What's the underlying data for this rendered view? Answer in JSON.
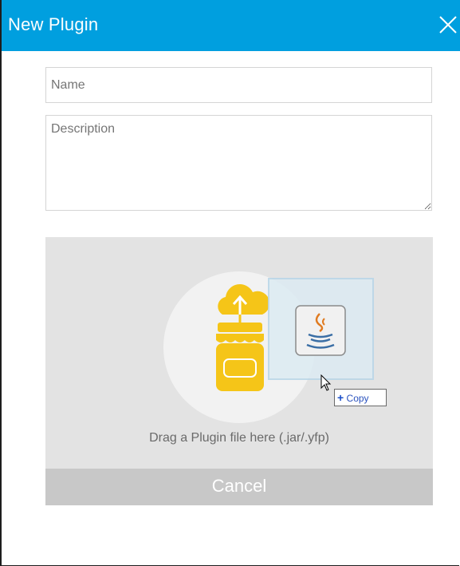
{
  "dialog": {
    "title": "New Plugin",
    "close_icon": "close-icon"
  },
  "form": {
    "name_placeholder": "Name",
    "description_placeholder": "Description"
  },
  "dropzone": {
    "instruction": "Drag a Plugin file here (.jar/.yfp)",
    "drag_tooltip": "Copy",
    "icons": [
      "cloud-upload-icon",
      "jar-icon",
      "java-file-icon",
      "mouse-cursor-icon",
      "plus-icon"
    ]
  },
  "actions": {
    "cancel_label": "Cancel"
  },
  "colors": {
    "titlebar": "#009fdf",
    "accent_yellow": "#f5c518",
    "dropzone_bg": "#e3e3e3",
    "cancel_bg": "#c8c8c8"
  }
}
